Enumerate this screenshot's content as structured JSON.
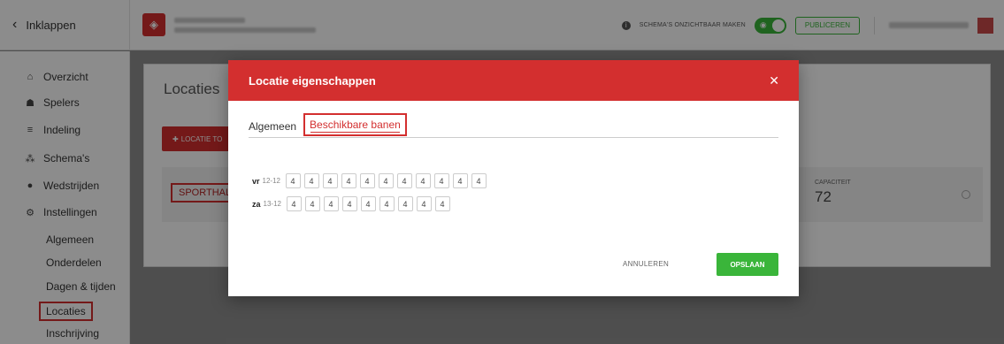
{
  "topbar": {
    "collapse_label": "Inklappen",
    "hide_schedules_label": "SCHEMA'S ONZICHTBAAR MAKEN",
    "publish_label": "PUBLICEREN"
  },
  "sidebar": {
    "items": [
      {
        "label": "Overzicht",
        "icon": "home-icon"
      },
      {
        "label": "Spelers",
        "icon": "users-icon"
      },
      {
        "label": "Indeling",
        "icon": "list-icon"
      },
      {
        "label": "Schema's",
        "icon": "sitemap-icon"
      },
      {
        "label": "Wedstrijden",
        "icon": "ball-icon"
      },
      {
        "label": "Instellingen",
        "icon": "gear-icon"
      }
    ],
    "sub_items": [
      {
        "label": "Algemeen"
      },
      {
        "label": "Onderdelen"
      },
      {
        "label": "Dagen & tijden"
      },
      {
        "label": "Locaties"
      },
      {
        "label": "Inschrijving"
      }
    ]
  },
  "content": {
    "title": "Locaties",
    "add_location_label": "LOCATIE TO",
    "location_name": "SPORTHAL",
    "capacity_label": "CAPACITEIT",
    "capacity_value": "72"
  },
  "modal": {
    "title": "Locatie eigenschappen",
    "tabs": [
      {
        "label": "Algemeen"
      },
      {
        "label": "Beschikbare banen"
      }
    ],
    "rows": [
      {
        "day": "vr",
        "date": "12-12",
        "values": [
          "4",
          "4",
          "4",
          "4",
          "4",
          "4",
          "4",
          "4",
          "4",
          "4",
          "4"
        ]
      },
      {
        "day": "za",
        "date": "13-12",
        "values": [
          "4",
          "4",
          "4",
          "4",
          "4",
          "4",
          "4",
          "4",
          "4"
        ]
      }
    ],
    "cancel_label": "ANNULEREN",
    "save_label": "OPSLAAN"
  }
}
